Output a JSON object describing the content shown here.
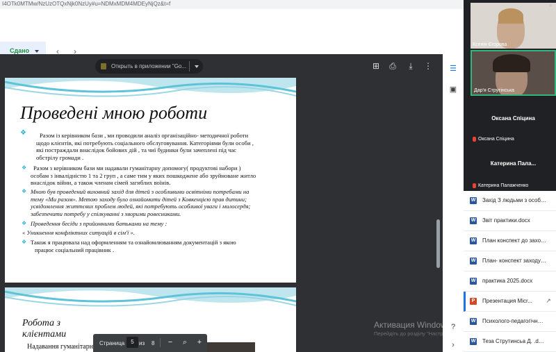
{
  "url": "I4OTk0MTMw/NzUzOTQxNjk0NzUy#u=NDMxMDM4MDEyNjQz&t=f",
  "header": {
    "status": "Сдано"
  },
  "viewer": {
    "open_in": "Открыть в приложении \"Go...",
    "pagebar": {
      "label": "Страница",
      "current": "5",
      "of": "из",
      "total": "8"
    },
    "activation": {
      "title": "Активация Windows",
      "subtitle": "Перейдіть до розділу \"Настройки\", щоб активувати Windows."
    }
  },
  "slide1": {
    "title": "Проведені мною  роботи",
    "bullets": [
      {
        "lines": [
          "Разом із керівником бази , ми проводили аналіз  організаційно- методичної  роботи",
          "щодо клієнтів,  які потребують соціального обслуговування.  Категоріями  були особи ,",
          "які постраждали внаслідок бойових  дій , та чиї  будинки були зачеплені під  час",
          "обстрілу громади ."
        ]
      },
      {
        "lines": [
          "Разом з  керівником бази ми надавали гуманітарну допомогу( продуктові набори )",
          "особам з інвалідністю 1 та 2 груп , а саме тим  у яких пошкоджене або зруйноване житло",
          "внаслідок війни, а також членам сімей загиблих воїнів."
        ]
      },
      {
        "lines": [
          "Мною був  проведений виховний захід для дітей  з особливими  освітніми потребами на",
          "тему «Ми разом».  Метою заходу було ознайомити  дітей з Ковкенцією  прав дитини;",
          "усвідомлення життєвих проблем людей, які потребують особливої уваги і милосердя;",
          "забезпечити потребу у спілкуванні з хворими ровесниками."
        ]
      },
      {
        "lines": [
          "Проведення бесіди з  прийомними батьками на тему :"
        ]
      },
      {
        "lines": [
          "« Уникнення конфліктних ситуацій в сім'ї »."
        ]
      },
      {
        "lines": [
          "Також  я працювала над  оформленням та ознайомлюванням документацій з якою",
          "працює  соціальний працівник ."
        ]
      }
    ]
  },
  "slide2": {
    "title": "Робота з клієнтами",
    "body": "Надавання  гуманітарну"
  },
  "participants": [
    {
      "name": "Ксенія Єгорова"
    },
    {
      "name": "Дар'я Струтінська"
    },
    {
      "name": "Оксана Спіцина",
      "label": "Оксана Спіцина"
    },
    {
      "name": "Катерина   Пала...",
      "label": "Катерина Палажченко"
    }
  ],
  "files": [
    {
      "name": "Захід З людьми з особл...",
      "type": "word"
    },
    {
      "name": "Звіт практики.docx",
      "type": "word"
    },
    {
      "name": "План конспект до заход...",
      "type": "word"
    },
    {
      "name": "План- конспект заходу 2...",
      "type": "word"
    },
    {
      "name": "практика 2025.docx",
      "type": "word"
    },
    {
      "name": "Презентация Micr...",
      "type": "ppt"
    },
    {
      "name": "Психолого-педагогічна х...",
      "type": "word"
    },
    {
      "name": "Теза Струтинсьа Д. .docx",
      "type": "word"
    }
  ],
  "colors": {
    "accent": "#1a73e8",
    "bullet": "#2ab0d1",
    "submitted": "#1e8e3e",
    "viewer_bg": "#2f3033",
    "meet_bg": "#202124"
  }
}
